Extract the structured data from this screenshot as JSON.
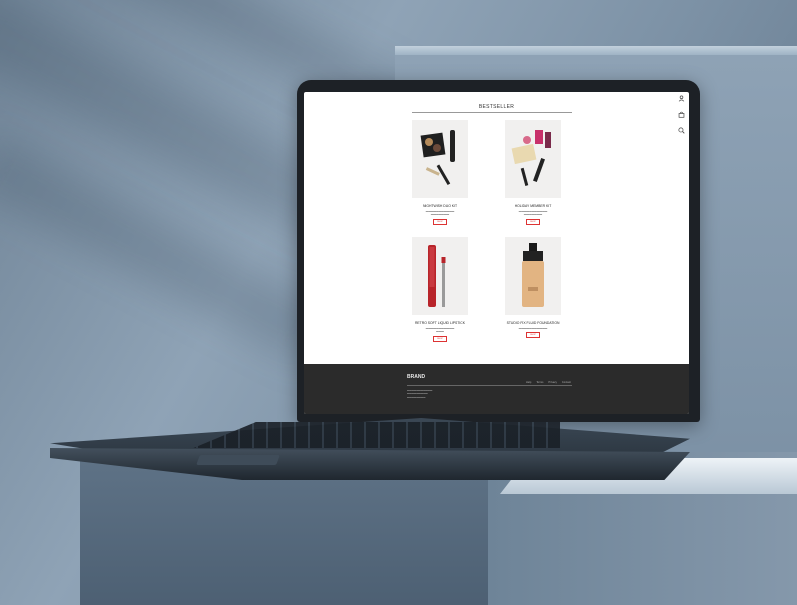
{
  "site": {
    "section_title": "BESTSELLER",
    "products": [
      {
        "name": "NIGHTWISH DUO KIT",
        "button": "SHOP"
      },
      {
        "name": "HOLIDAY MEMBER KIT",
        "button": "SHOP"
      },
      {
        "name": "RETRO SOFT LIQUID LIPSTICK",
        "button": "SHOP"
      },
      {
        "name": "STUDIO FIX FLUID FOUNDATION",
        "button": "SHOP"
      }
    ],
    "footer": {
      "logo": "BRAND",
      "links": [
        "Help",
        "Terms",
        "Privacy",
        "Contact"
      ]
    },
    "icons": [
      "user-icon",
      "bag-icon",
      "search-icon"
    ]
  },
  "colors": {
    "accent": "#d33333",
    "footer_bg": "#2b2b2b",
    "background": "#8fa3b6"
  }
}
